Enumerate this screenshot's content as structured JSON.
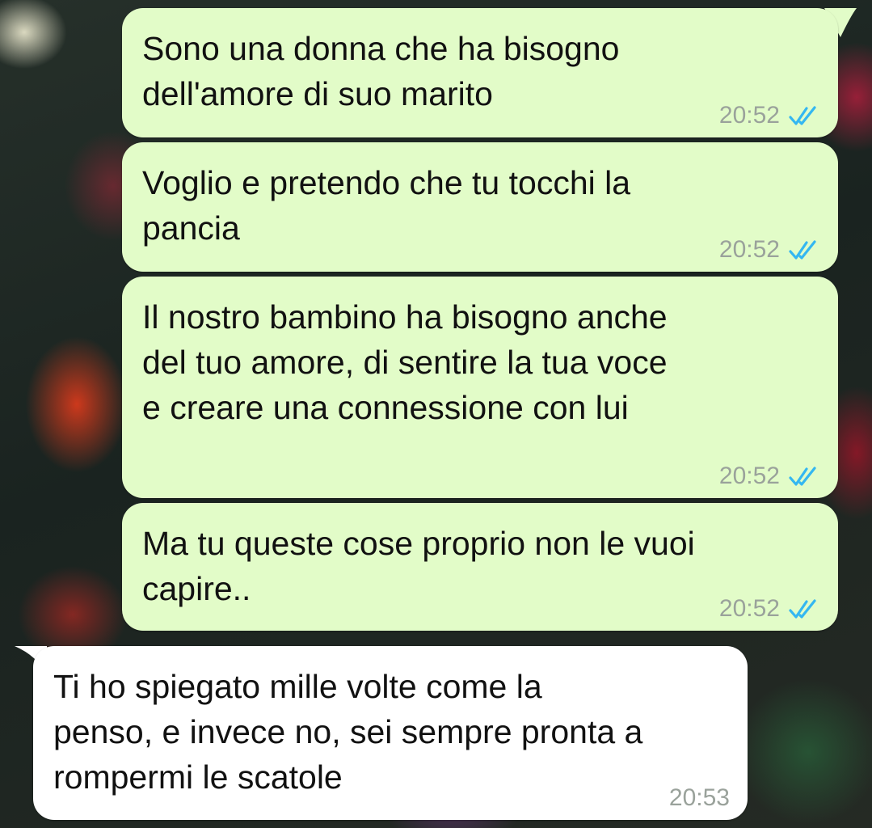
{
  "messages": [
    {
      "direction": "outgoing",
      "text": "Sono una donna che ha bisogno\ndell'amore di suo marito",
      "time": "20:52",
      "status": "read"
    },
    {
      "direction": "outgoing",
      "text": "Voglio e pretendo che tu tocchi la\npancia",
      "time": "20:52",
      "status": "read"
    },
    {
      "direction": "outgoing",
      "text": "Il nostro bambino ha bisogno anche\ndel tuo amore, di sentire la tua voce\ne creare una connessione con lui",
      "time": "20:52",
      "status": "read"
    },
    {
      "direction": "outgoing",
      "text": "Ma tu queste cose proprio non le vuoi\ncapire..",
      "time": "20:52",
      "status": "read"
    },
    {
      "direction": "incoming",
      "text": "Ti ho spiegato mille volte come la\npenso, e invece no, sei sempre pronta a\nrompermi le scatole",
      "time": "20:53"
    }
  ],
  "icons": {
    "read_receipt": "double-check-icon"
  },
  "colors": {
    "outgoing_bubble": "#e2fcc8",
    "incoming_bubble": "#ffffff",
    "read_tick": "#34b7f1",
    "timestamp": "#9aa29b"
  }
}
